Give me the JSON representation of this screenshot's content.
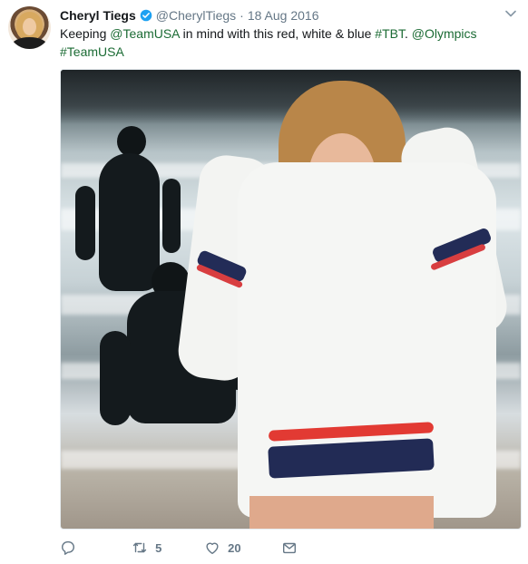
{
  "tweet": {
    "author": {
      "name": "Cheryl Tiegs",
      "handle": "@CherylTiegs",
      "separator": "·",
      "date": "18 Aug 2016",
      "avatar_icon": "profile-avatar-icon"
    },
    "text_parts": [
      {
        "text": "Keeping ",
        "kind": "plain"
      },
      {
        "text": "@TeamUSA",
        "kind": "link"
      },
      {
        "text": " in mind with this  red, white & blue ",
        "kind": "plain"
      },
      {
        "text": "#TBT",
        "kind": "link"
      },
      {
        "text": ".  ",
        "kind": "plain"
      },
      {
        "text": "@Olympics",
        "kind": "link"
      },
      {
        "text": " ",
        "kind": "plain"
      },
      {
        "text": "#TeamUSA",
        "kind": "link"
      }
    ],
    "photo": {
      "description_icon": "beach-photo-image"
    },
    "actions": {
      "reply": {
        "count": ""
      },
      "retweet": {
        "count": "5"
      },
      "like": {
        "count": "20"
      },
      "message": {
        "count": ""
      }
    },
    "colors": {
      "link": "#1b6b34",
      "verified": "#1da1f2",
      "muted": "#657786",
      "text": "#14171a"
    }
  }
}
